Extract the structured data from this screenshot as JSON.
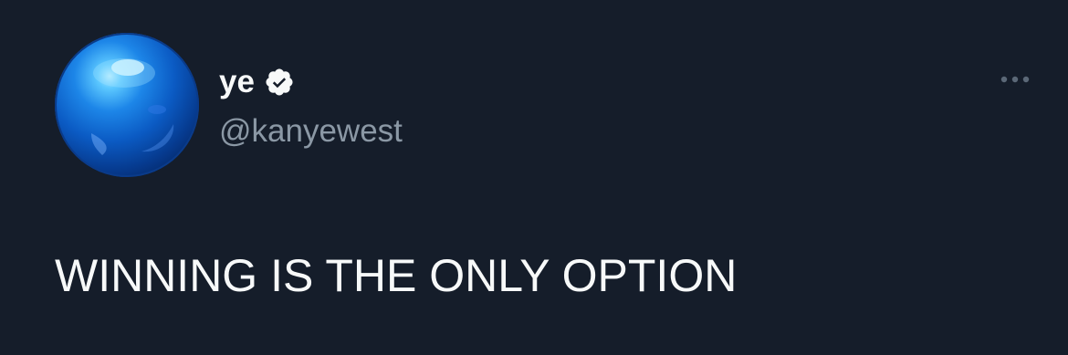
{
  "tweet": {
    "display_name": "ye",
    "handle": "@kanyewest",
    "text": "WINNING IS THE ONLY OPTION",
    "verified": true,
    "icons": {
      "verified": "verified-badge-icon",
      "more": "more-options-icon",
      "avatar": "avatar-image"
    }
  },
  "colors": {
    "background": "#151d2a",
    "primary_text": "#f7f9f9",
    "secondary_text": "#8b98a5",
    "verified_badge": "#f7f9f9"
  }
}
